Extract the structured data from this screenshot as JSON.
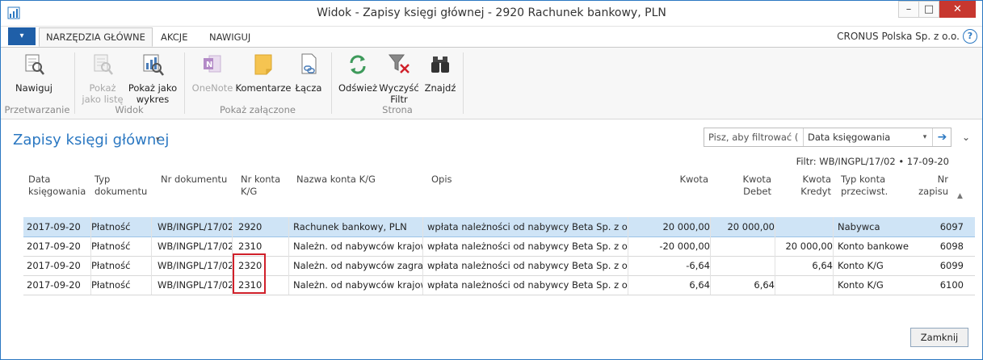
{
  "window": {
    "title": "Widok - Zapisy księgi głównej - 2920 Rachunek bankowy, PLN",
    "minimize": "–",
    "maximize": "□",
    "close": "✕"
  },
  "ribbon_tabs": {
    "menu": "▾",
    "items": [
      "NARZĘDZIA GŁÓWNE",
      "AKCJE",
      "NAWIGUJ"
    ],
    "company": "CRONUS Polska Sp. z o.o.",
    "help": "?"
  },
  "ribbon": {
    "groups": {
      "processing": {
        "label": "Przetwarzanie",
        "navigate": "Nawiguj"
      },
      "view": {
        "label": "Widok",
        "show_list": [
          "Pokaż",
          "jako listę"
        ],
        "show_chart": [
          "Pokaż jako",
          "wykres"
        ]
      },
      "attachments": {
        "label": "Pokaż załączone",
        "onenote": "OneNote",
        "comments": "Komentarze",
        "links": "Łącza"
      },
      "page": {
        "label": "Strona",
        "refresh": "Odśwież",
        "clear_filter": [
          "Wyczyść",
          "Filtr"
        ],
        "find": "Znajdź"
      }
    }
  },
  "page": {
    "title": "Zapisy księgi głównej",
    "title_caret": "▾",
    "collapse_chevron": "⌄",
    "filter_placeholder": "Pisz, aby filtrować (...",
    "filter_field": "Data księgowania",
    "filter_caret": "▾",
    "filter_go": "➔",
    "filter_text": "Filtr: WB/INGPL/17/02 • 17-09-20"
  },
  "table": {
    "headers": {
      "posting_date": [
        "Data",
        "księgowania"
      ],
      "doc_type": [
        "Typ",
        "dokumentu"
      ],
      "doc_no": [
        "Nr dokumentu"
      ],
      "acc_no": [
        "Nr konta",
        "K/G"
      ],
      "acc_name": [
        "Nazwa konta K/G"
      ],
      "desc": [
        "Opis"
      ],
      "amount": [
        "Kwota"
      ],
      "debit": [
        "Kwota",
        "Debet"
      ],
      "credit": [
        "Kwota",
        "Kredyt"
      ],
      "bal_type": [
        "Typ konta",
        "przeciwst."
      ],
      "entry_no": [
        "Nr",
        "zapisu"
      ]
    },
    "sort_indicator": "▲",
    "rows": [
      {
        "date": "2017-09-20",
        "type": "Płatność",
        "doc": "WB/INGPL/17/02",
        "acc": "2920",
        "name": "Rachunek bankowy, PLN",
        "desc": "wpłata należności od nabywcy Beta Sp. z o.o.",
        "amount": "20 000,00",
        "debit": "20 000,00",
        "credit": "",
        "bal": "Nabywca",
        "no": "6097"
      },
      {
        "date": "2017-09-20",
        "type": "Płatność",
        "doc": "WB/INGPL/17/02",
        "acc": "2310",
        "name": "Należn. od nabywców krajow.",
        "desc": "wpłata należności od nabywcy Beta Sp. z o.o.",
        "amount": "-20 000,00",
        "debit": "",
        "credit": "20 000,00",
        "bal": "Konto bankowe",
        "no": "6098"
      },
      {
        "date": "2017-09-20",
        "type": "Płatność",
        "doc": "WB/INGPL/17/02",
        "acc": "2320",
        "name": "Należn. od nabywców zagran.",
        "desc": "wpłata należności od nabywcy Beta Sp. z o.o.",
        "amount": "-6,64",
        "debit": "",
        "credit": "6,64",
        "bal": "Konto K/G",
        "no": "6099"
      },
      {
        "date": "2017-09-20",
        "type": "Płatność",
        "doc": "WB/INGPL/17/02",
        "acc": "2310",
        "name": "Należn. od nabywców krajow.",
        "desc": "wpłata należności od nabywcy Beta Sp. z o.o.",
        "amount": "6,64",
        "debit": "6,64",
        "credit": "",
        "bal": "Konto K/G",
        "no": "6100"
      }
    ]
  },
  "footer": {
    "close_label": "Zamknij"
  },
  "colors": {
    "accent": "#2b78c2",
    "selected_row": "#cfe4f6",
    "highlight_box": "#d0202a"
  }
}
